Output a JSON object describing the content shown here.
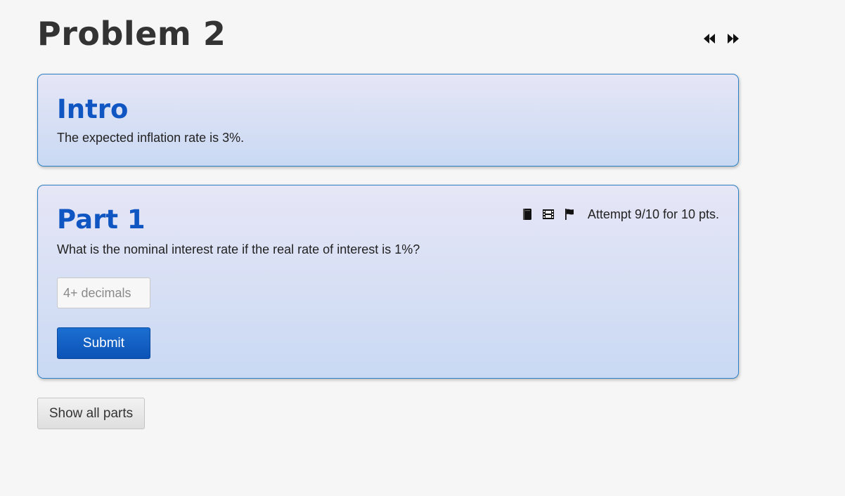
{
  "problem": {
    "title": "Problem 2"
  },
  "nav": {
    "prev_icon": "rewind-icon",
    "next_icon": "fast-forward-icon"
  },
  "intro": {
    "heading": "Intro",
    "text": "The expected inflation rate is 3%."
  },
  "part1": {
    "heading": "Part 1",
    "question": "What is the nominal interest rate if the real rate of interest is 1%?",
    "attempt_text": "Attempt 9/10 for 10 pts.",
    "tools": [
      "book-icon",
      "film-icon",
      "flag-icon"
    ],
    "answer": {
      "value": "",
      "placeholder": "4+ decimals"
    },
    "submit_label": "Submit"
  },
  "footer": {
    "show_all_label": "Show all parts"
  },
  "colors": {
    "heading_blue": "#1056c3",
    "card_border": "#2c7fc3",
    "submit_bg": "#0c52b7"
  }
}
